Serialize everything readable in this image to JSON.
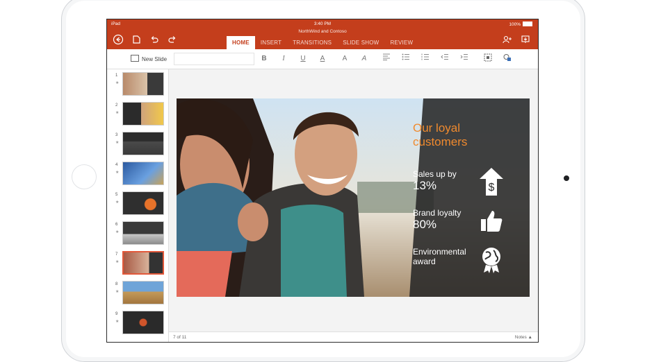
{
  "status_bar": {
    "device": "iPad",
    "time": "3:40 PM",
    "battery": "100%"
  },
  "document": {
    "title": "NorthWind and Contoso"
  },
  "tabs": [
    {
      "label": "HOME",
      "active": true
    },
    {
      "label": "INSERT",
      "active": false
    },
    {
      "label": "TRANSITIONS",
      "active": false
    },
    {
      "label": "SLIDE SHOW",
      "active": false
    },
    {
      "label": "REVIEW",
      "active": false
    }
  ],
  "toolbar": {
    "back_icon": "back-arrow-icon",
    "file_icon": "file-icon",
    "undo_icon": "undo-icon",
    "redo_icon": "redo-icon",
    "share_icon": "add-person-icon",
    "present_icon": "present-icon"
  },
  "ribbon": {
    "new_slide_label": "New Slide",
    "bold": "B",
    "italic": "I",
    "underline": "U",
    "font_color": "A",
    "highlight": "A",
    "text_effects": "A"
  },
  "thumbnails": [
    {
      "number": "1",
      "selected": false
    },
    {
      "number": "2",
      "selected": false
    },
    {
      "number": "3",
      "selected": false
    },
    {
      "number": "4",
      "selected": false
    },
    {
      "number": "5",
      "selected": false
    },
    {
      "number": "6",
      "selected": false
    },
    {
      "number": "7",
      "selected": true
    },
    {
      "number": "8",
      "selected": false
    },
    {
      "number": "9",
      "selected": false
    }
  ],
  "slide": {
    "title": "Our loyal customers",
    "stats": [
      {
        "label": "Sales up by",
        "value": "13%",
        "icon": "dollar-arrow-icon"
      },
      {
        "label": "Brand loyalty",
        "value": "80%",
        "icon": "thumbs-up-icon"
      },
      {
        "label": "Environmental award",
        "value": "",
        "icon": "globe-award-icon"
      }
    ]
  },
  "footer": {
    "slide_count": "7 of 11",
    "notes_label": "Notes ▲"
  },
  "colors": {
    "accent": "#c43e1c",
    "title_orange": "#f08a2e"
  }
}
